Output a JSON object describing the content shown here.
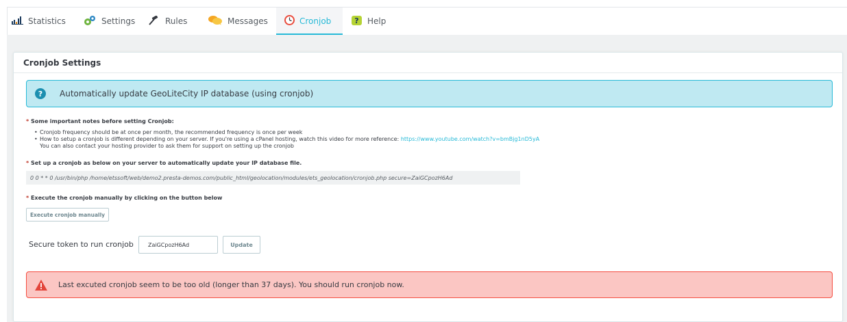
{
  "tabs": [
    {
      "label": "Statistics",
      "icon": "bar-chart-icon",
      "active": false
    },
    {
      "label": "Settings",
      "icon": "gears-icon",
      "active": false
    },
    {
      "label": "Rules",
      "icon": "gavel-icon",
      "active": false
    },
    {
      "label": "Messages",
      "icon": "chat-bubble-icon",
      "active": false
    },
    {
      "label": "Cronjob",
      "icon": "clock-icon",
      "active": true
    },
    {
      "label": "Help",
      "icon": "help-question-icon",
      "active": false
    }
  ],
  "panel": {
    "title": "Cronjob Settings",
    "info_alert": "Automatically update GeoLiteCity IP database (using cronjob)",
    "notes_heading": "Some important notes before setting Cronjob:",
    "notes": {
      "item1": "Cronjob frequency should be at once per month, the recommended frequency is once per week",
      "item2": "How to setup a cronjob is different depending on your server. If you're using a cPanel hosting, watch this video for more reference:",
      "item2_link": "https://www.youtube.com/watch?v=bmBjg1nD5yA",
      "item2_cont": "You can also contact your hosting provider to ask them for support on setting up the cronjob"
    },
    "setup_heading": "Set up a cronjob as below on your server to automatically update your IP database file.",
    "cron_command": "0 0 * * 0 /usr/bin/php /home/etssoft/web/demo2.presta-demos.com/public_html/geolocation/modules/ets_geolocation/cronjob.php secure=ZaiGCpozH6Ad",
    "execute_heading": "Execute the cronjob manually by clicking on the button below",
    "execute_button": "Execute cronjob manually",
    "token_label": "Secure token to run cronjob",
    "token_value": "ZaiGCpozH6Ad",
    "update_button": "Update",
    "danger_alert": "Last excuted cronjob seem to be too old (longer than 37 days). You should run cronjob now."
  },
  "colors": {
    "accent": "#25b9d7",
    "info_bg": "#bfe9f2",
    "danger_bg": "#fbc6c3",
    "danger_border": "#f54c3e",
    "required": "#c0392b"
  }
}
